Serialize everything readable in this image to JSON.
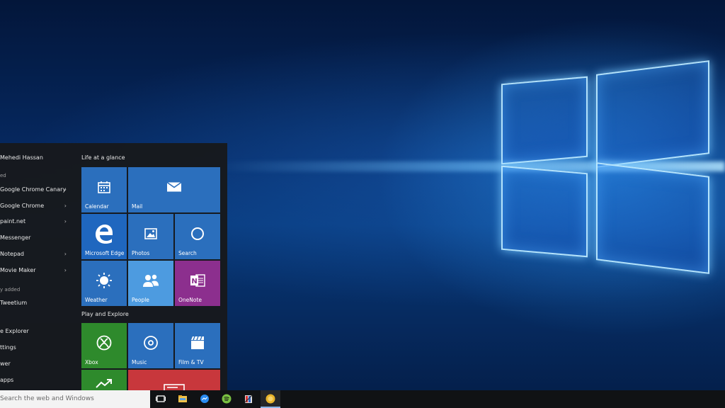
{
  "start_menu": {
    "user_name": "Mehedi Hassan",
    "sections": {
      "most_used": "ed",
      "recently_added": "y added"
    },
    "apps": [
      {
        "label": "Google Chrome Canary",
        "chevron": "›"
      },
      {
        "label": "Google Chrome",
        "chevron": "›"
      },
      {
        "label": "paint.net",
        "chevron": "›"
      },
      {
        "label": "Messenger",
        "chevron": ""
      },
      {
        "label": "Notepad",
        "chevron": "›"
      },
      {
        "label": "Movie Maker",
        "chevron": "›"
      }
    ],
    "recent_apps": [
      {
        "label": "Tweetium"
      }
    ],
    "system_items": [
      {
        "label": "e Explorer"
      },
      {
        "label": "ttings"
      },
      {
        "label": "wer"
      },
      {
        "label": "apps"
      }
    ],
    "groups": [
      {
        "title": "Life at a glance"
      },
      {
        "title": "Play and Explore"
      }
    ],
    "tiles": [
      {
        "label": "Calendar",
        "icon": "calendar-icon",
        "color": "#2b6fbd"
      },
      {
        "label": "Mail",
        "icon": "mail-icon",
        "color": "#2b6fbd"
      },
      {
        "label": "Microsoft Edge",
        "icon": "edge-icon",
        "color": "#1f67bf"
      },
      {
        "label": "Photos",
        "icon": "photos-icon",
        "color": "#2b6fbd"
      },
      {
        "label": "Search",
        "icon": "search-icon",
        "color": "#2b6fbd"
      },
      {
        "label": "Weather",
        "icon": "weather-icon",
        "color": "#2b6fbd"
      },
      {
        "label": "People",
        "icon": "people-icon",
        "color": "#4d9be0"
      },
      {
        "label": "OneNote",
        "icon": "onenote-icon",
        "color": "#8c2f8e"
      },
      {
        "label": "Xbox",
        "icon": "xbox-icon",
        "color": "#2e8a2c"
      },
      {
        "label": "Music",
        "icon": "music-icon",
        "color": "#2b6fbd"
      },
      {
        "label": "Film & TV",
        "icon": "film-icon",
        "color": "#2b6fbd"
      },
      {
        "label": "",
        "icon": "money-icon",
        "color": "#2e8a2c"
      },
      {
        "label": "",
        "icon": "news-icon",
        "color": "#c8373c"
      }
    ]
  },
  "taskbar": {
    "search_placeholder": "Search the web and Windows",
    "icons": [
      "task-view-icon",
      "file-explorer-icon",
      "messenger-icon",
      "spotify-icon",
      "paint-net-icon",
      "tweetium-icon"
    ]
  }
}
